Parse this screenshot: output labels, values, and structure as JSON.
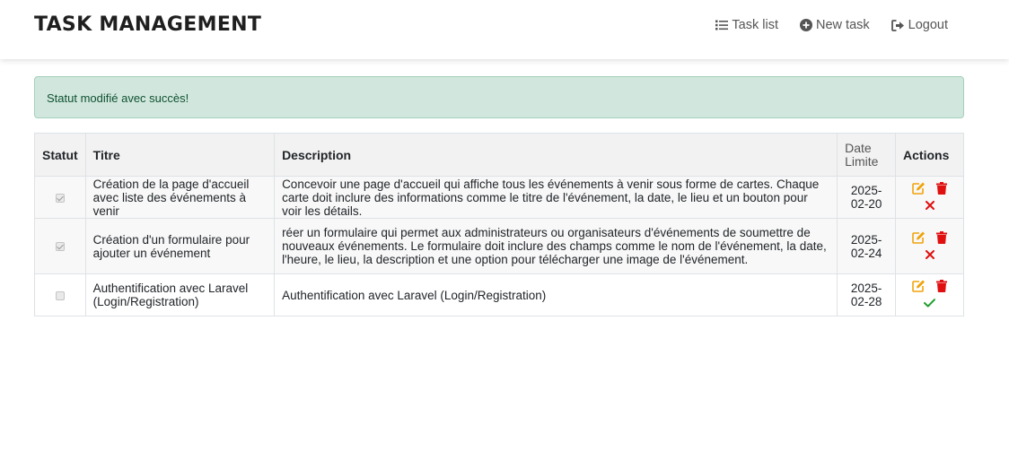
{
  "navbar": {
    "brand": "TASK MANAGEMENT",
    "links": [
      {
        "label": "Task list",
        "icon": "list-icon"
      },
      {
        "label": "New task",
        "icon": "plus-circle-icon"
      },
      {
        "label": "Logout",
        "icon": "sign-out-icon"
      }
    ]
  },
  "alert": {
    "message": "Statut modifié avec succès!",
    "type": "success"
  },
  "table": {
    "headers": {
      "status": "Statut",
      "title": "Titre",
      "description": "Description",
      "deadline_line1": "Date",
      "deadline_line2": "Limite",
      "actions": "Actions"
    },
    "rows": [
      {
        "completed": true,
        "title": "Création de la page d'accueil avec liste des événements à venir",
        "description": "Concevoir une page d'accueil qui affiche tous les événements à venir sous forme de cartes. Chaque carte doit inclure des informations comme le titre de l'événement, la date, le lieu et un bouton pour voir les détails.",
        "deadline_part1": "2025-",
        "deadline_part2": "02-20",
        "toggle_action": "mark-incomplete"
      },
      {
        "completed": true,
        "title": "Création d'un formulaire pour ajouter un événement",
        "description": "réer un formulaire qui permet aux administrateurs ou organisateurs d'événements de soumettre de nouveaux événements. Le formulaire doit inclure des champs comme le nom de l'événement, la date, l'heure, le lieu, la description et une option pour télécharger une image de l'événement.",
        "deadline_part1": "2025-",
        "deadline_part2": "02-24",
        "toggle_action": "mark-incomplete"
      },
      {
        "completed": false,
        "title": "Authentification avec Laravel (Login/Registration)",
        "description": "Authentification avec Laravel (Login/Registration)",
        "deadline_part1": "2025-",
        "deadline_part2": "02-28",
        "toggle_action": "mark-complete"
      }
    ]
  },
  "colors": {
    "alert_bg": "#d1e7dd",
    "alert_text": "#0f5132",
    "edit_icon": "#f0a30a",
    "delete_icon": "#e01010",
    "uncomplete_icon": "#e01010",
    "complete_icon": "#1f9e2f"
  }
}
